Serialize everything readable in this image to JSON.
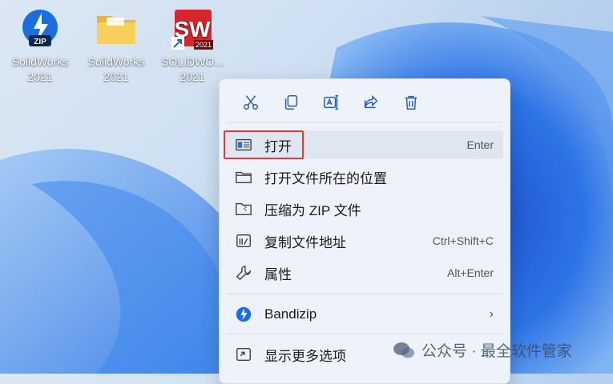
{
  "desktop_icons": [
    {
      "label": "SolidWorks 2021",
      "icon": "bandizip-zip-icon"
    },
    {
      "label": "SolidWorks 2021",
      "icon": "folder-icon"
    },
    {
      "label": "SOLIDWO... 2021",
      "icon": "solidworks-shortcut-icon"
    }
  ],
  "context_menu": {
    "quick_actions": [
      "cut-icon",
      "copy-icon",
      "rename-icon",
      "share-icon",
      "delete-icon"
    ],
    "items": [
      {
        "label": "打开",
        "shortcut": "Enter",
        "icon": "open-app-icon"
      },
      {
        "label": "打开文件所在的位置",
        "shortcut": "",
        "icon": "folder-open-icon"
      },
      {
        "label": "压缩为 ZIP 文件",
        "shortcut": "",
        "icon": "zip-folder-icon"
      },
      {
        "label": "复制文件地址",
        "shortcut": "Ctrl+Shift+C",
        "icon": "copy-path-icon"
      },
      {
        "label": "属性",
        "shortcut": "Alt+Enter",
        "icon": "wrench-icon"
      },
      {
        "label": "Bandizip",
        "shortcut": "",
        "icon": "bandizip-icon"
      },
      {
        "label": "显示更多选项",
        "shortcut": "",
        "icon": "more-options-icon"
      }
    ]
  },
  "watermark": "公众号 · 最全软件管家",
  "colors": {
    "accent": "#2d5fb0",
    "highlight": "#e03a3a",
    "menu_bg": "#eef2fa"
  }
}
